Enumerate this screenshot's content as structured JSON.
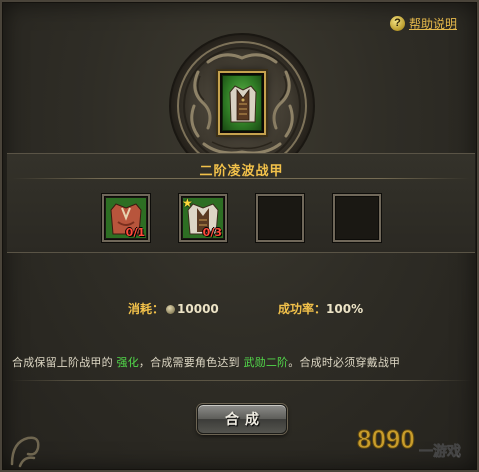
{
  "help": {
    "label": "帮助说明",
    "icon": "question-icon"
  },
  "item_title": "二阶凌波战甲",
  "result_item": {
    "icon": "vest-armor-icon",
    "frame_color": "#3f9a35"
  },
  "materials": [
    {
      "icon": "red-armor-icon",
      "count": "0/1",
      "starred": false
    },
    {
      "icon": "white-vest-armor-icon",
      "count": "0/3",
      "starred": true
    },
    {
      "icon": "",
      "count": "",
      "starred": false
    },
    {
      "icon": "",
      "count": "",
      "starred": false
    }
  ],
  "cost": {
    "label": "消耗：",
    "icon": "coin-icon",
    "value": "10000"
  },
  "success": {
    "label": "成功率：",
    "value": "100%"
  },
  "description": {
    "part1": "合成保留上阶战甲的",
    "highlight1": "强化",
    "part2": "，合成需要角色达到",
    "highlight2": "武勋二阶",
    "part3": "。合成时必须穿戴战甲"
  },
  "button_label": "合成",
  "watermark": {
    "text": "8090",
    "sub": "一游戏"
  },
  "colors": {
    "gold": "#f2c14a",
    "highlight": "#52d94a",
    "count": "#ff4a3a"
  }
}
